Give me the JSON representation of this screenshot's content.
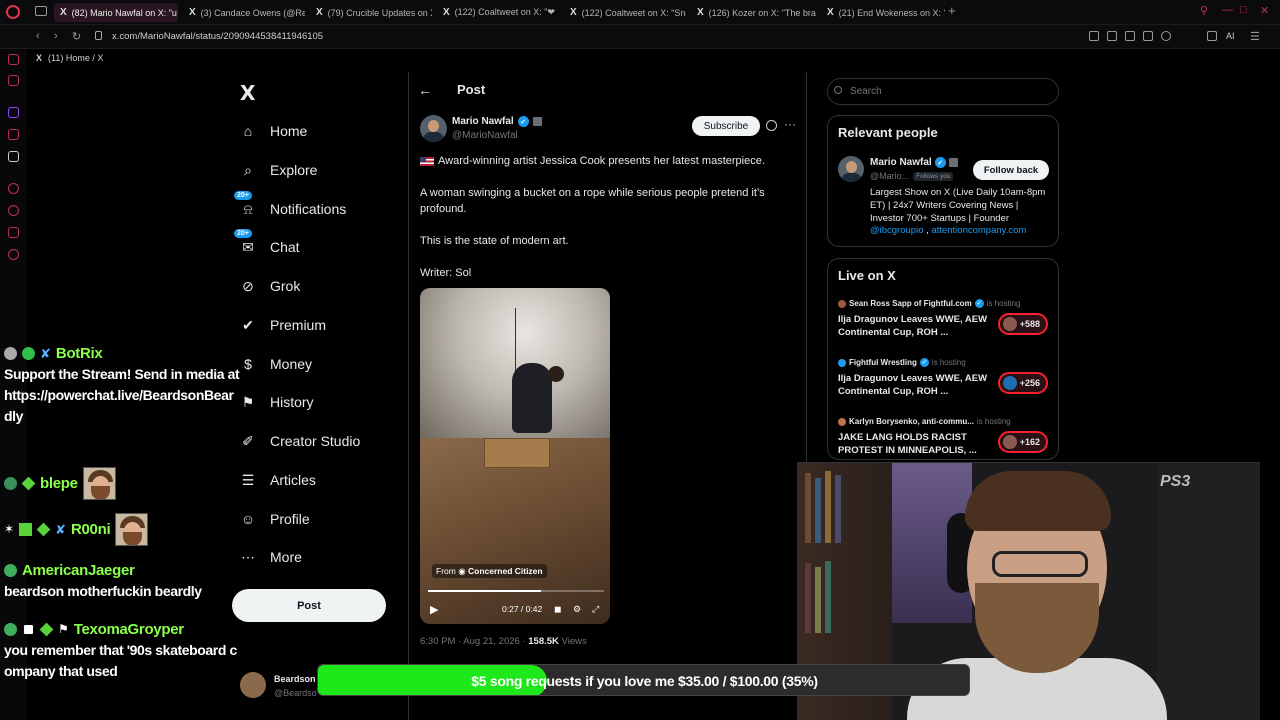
{
  "browser": {
    "tabs": [
      {
        "title": "(82) Mario Nawfal on X: \"u",
        "active": true
      },
      {
        "title": "(3) Candace Owens (@Re",
        "active": false
      },
      {
        "title": "(79) Crucible Updates on X",
        "active": false
      },
      {
        "title": "(122) Coaltweet on X: \"❤",
        "active": false
      },
      {
        "title": "(122) Coaltweet on X: \"Sne",
        "active": false
      },
      {
        "title": "(126) Kozer on X: \"The bra",
        "active": false
      },
      {
        "title": "(21) End Wokeness on X: \"",
        "active": false
      }
    ],
    "new_tab": "+",
    "url": "x.com/MarioNawfal/status/2090944538411946105",
    "bookmark": "(11) Home / X",
    "ai_label": "AI"
  },
  "x_nav": {
    "logo": "X",
    "items": [
      {
        "label": "Home",
        "icon": "home-icon",
        "badge": ""
      },
      {
        "label": "Explore",
        "icon": "search-icon",
        "badge": ""
      },
      {
        "label": "Notifications",
        "icon": "bell-icon",
        "badge": "20+"
      },
      {
        "label": "Chat",
        "icon": "chat-icon",
        "badge": "20+"
      },
      {
        "label": "Grok",
        "icon": "grok-icon",
        "badge": ""
      },
      {
        "label": "Premium",
        "icon": "premium-icon",
        "badge": ""
      },
      {
        "label": "Money",
        "icon": "money-icon",
        "badge": ""
      },
      {
        "label": "History",
        "icon": "bookmark-icon",
        "badge": ""
      },
      {
        "label": "Creator Studio",
        "icon": "creator-icon",
        "badge": ""
      },
      {
        "label": "Articles",
        "icon": "articles-icon",
        "badge": ""
      },
      {
        "label": "Profile",
        "icon": "person-icon",
        "badge": ""
      },
      {
        "label": "More",
        "icon": "more-icon",
        "badge": ""
      }
    ],
    "post_button": "Post",
    "account": {
      "name": "Beardson",
      "handle": "@Beardso"
    }
  },
  "post": {
    "header": "Post",
    "author": {
      "name": "Mario Nawfal",
      "handle": "@MarioNawfal"
    },
    "subscribe": "Subscribe",
    "lines": [
      "Award-winning artist Jessica Cook presents her latest masterpiece.",
      "A woman swinging a bucket on a rope while serious people pretend it’s profound.",
      "This is the state of modern art.",
      "Writer: Sol"
    ],
    "video": {
      "from_prefix": "From",
      "from_name": "Concerned Citizen",
      "time": "0:27 / 0:42",
      "progress": 0.64
    },
    "meta": {
      "time": "6:30 PM · Aug 21, 2026 ·",
      "views_count": "158.5K",
      "views_label": "Views"
    }
  },
  "right": {
    "search_placeholder": "Search",
    "relevant": {
      "title": "Relevant people",
      "name": "Mario Nawfal",
      "handle": "@Mario...",
      "follows_you": "Follows you",
      "follow_back": "Follow back",
      "bio": "Largest Show on X (Live Daily 10am-8pm ET) | 24x7 Writers Covering News | Investor 700+ Startups | Founder",
      "link1": "@ibcgroupio",
      "link_sep": " , ",
      "link2": "attentioncompany.com"
    },
    "live": {
      "title": "Live on X",
      "items": [
        {
          "host": "Sean Ross Sapp of Fightful.com",
          "status": "is hosting",
          "title": "Ilja Dragunov Leaves WWE, AEW Continental Cup, ROH ...",
          "count": "+588"
        },
        {
          "host": "Fightful Wrestling",
          "status": "is hosting",
          "title": "Ilja Dragunov Leaves WWE, AEW Continental Cup, ROH ...",
          "count": "+256"
        },
        {
          "host": "Karlyn Borysenko, anti-commu...",
          "status": "is hosting",
          "title": "JAKE LANG HOLDS RACIST PROTEST IN MINNEAPOLIS, ...",
          "count": "+162"
        }
      ]
    }
  },
  "stream": {
    "chat": [
      {
        "name": "BotRix",
        "color": "#8cff4a",
        "text": "Support the Stream! Send in media at https://powerchat.live/BeardsonBeardly"
      },
      {
        "name": "blepe",
        "color": "#8cff4a",
        "text": ""
      },
      {
        "name": "R00ni",
        "color": "#8cff4a",
        "text": ""
      },
      {
        "name": "AmericanJaeger",
        "color": "#8cff4a",
        "text": "beardson motherfuckin beardly"
      },
      {
        "name": "TexomaGroyper",
        "color": "#8cff4a",
        "text": "you remember that '90s skateboard company that used"
      }
    ],
    "goal": {
      "text": "$5 song requests if you love me $35.00 / $100.00 (35%)",
      "progress": 0.35,
      "fill_color": "#1ee81a"
    },
    "webcam_brand": "PS3"
  },
  "colors": {
    "accent": "#1d9bf0",
    "live_red": "#f4212e",
    "browser_accent": "#c03050"
  }
}
